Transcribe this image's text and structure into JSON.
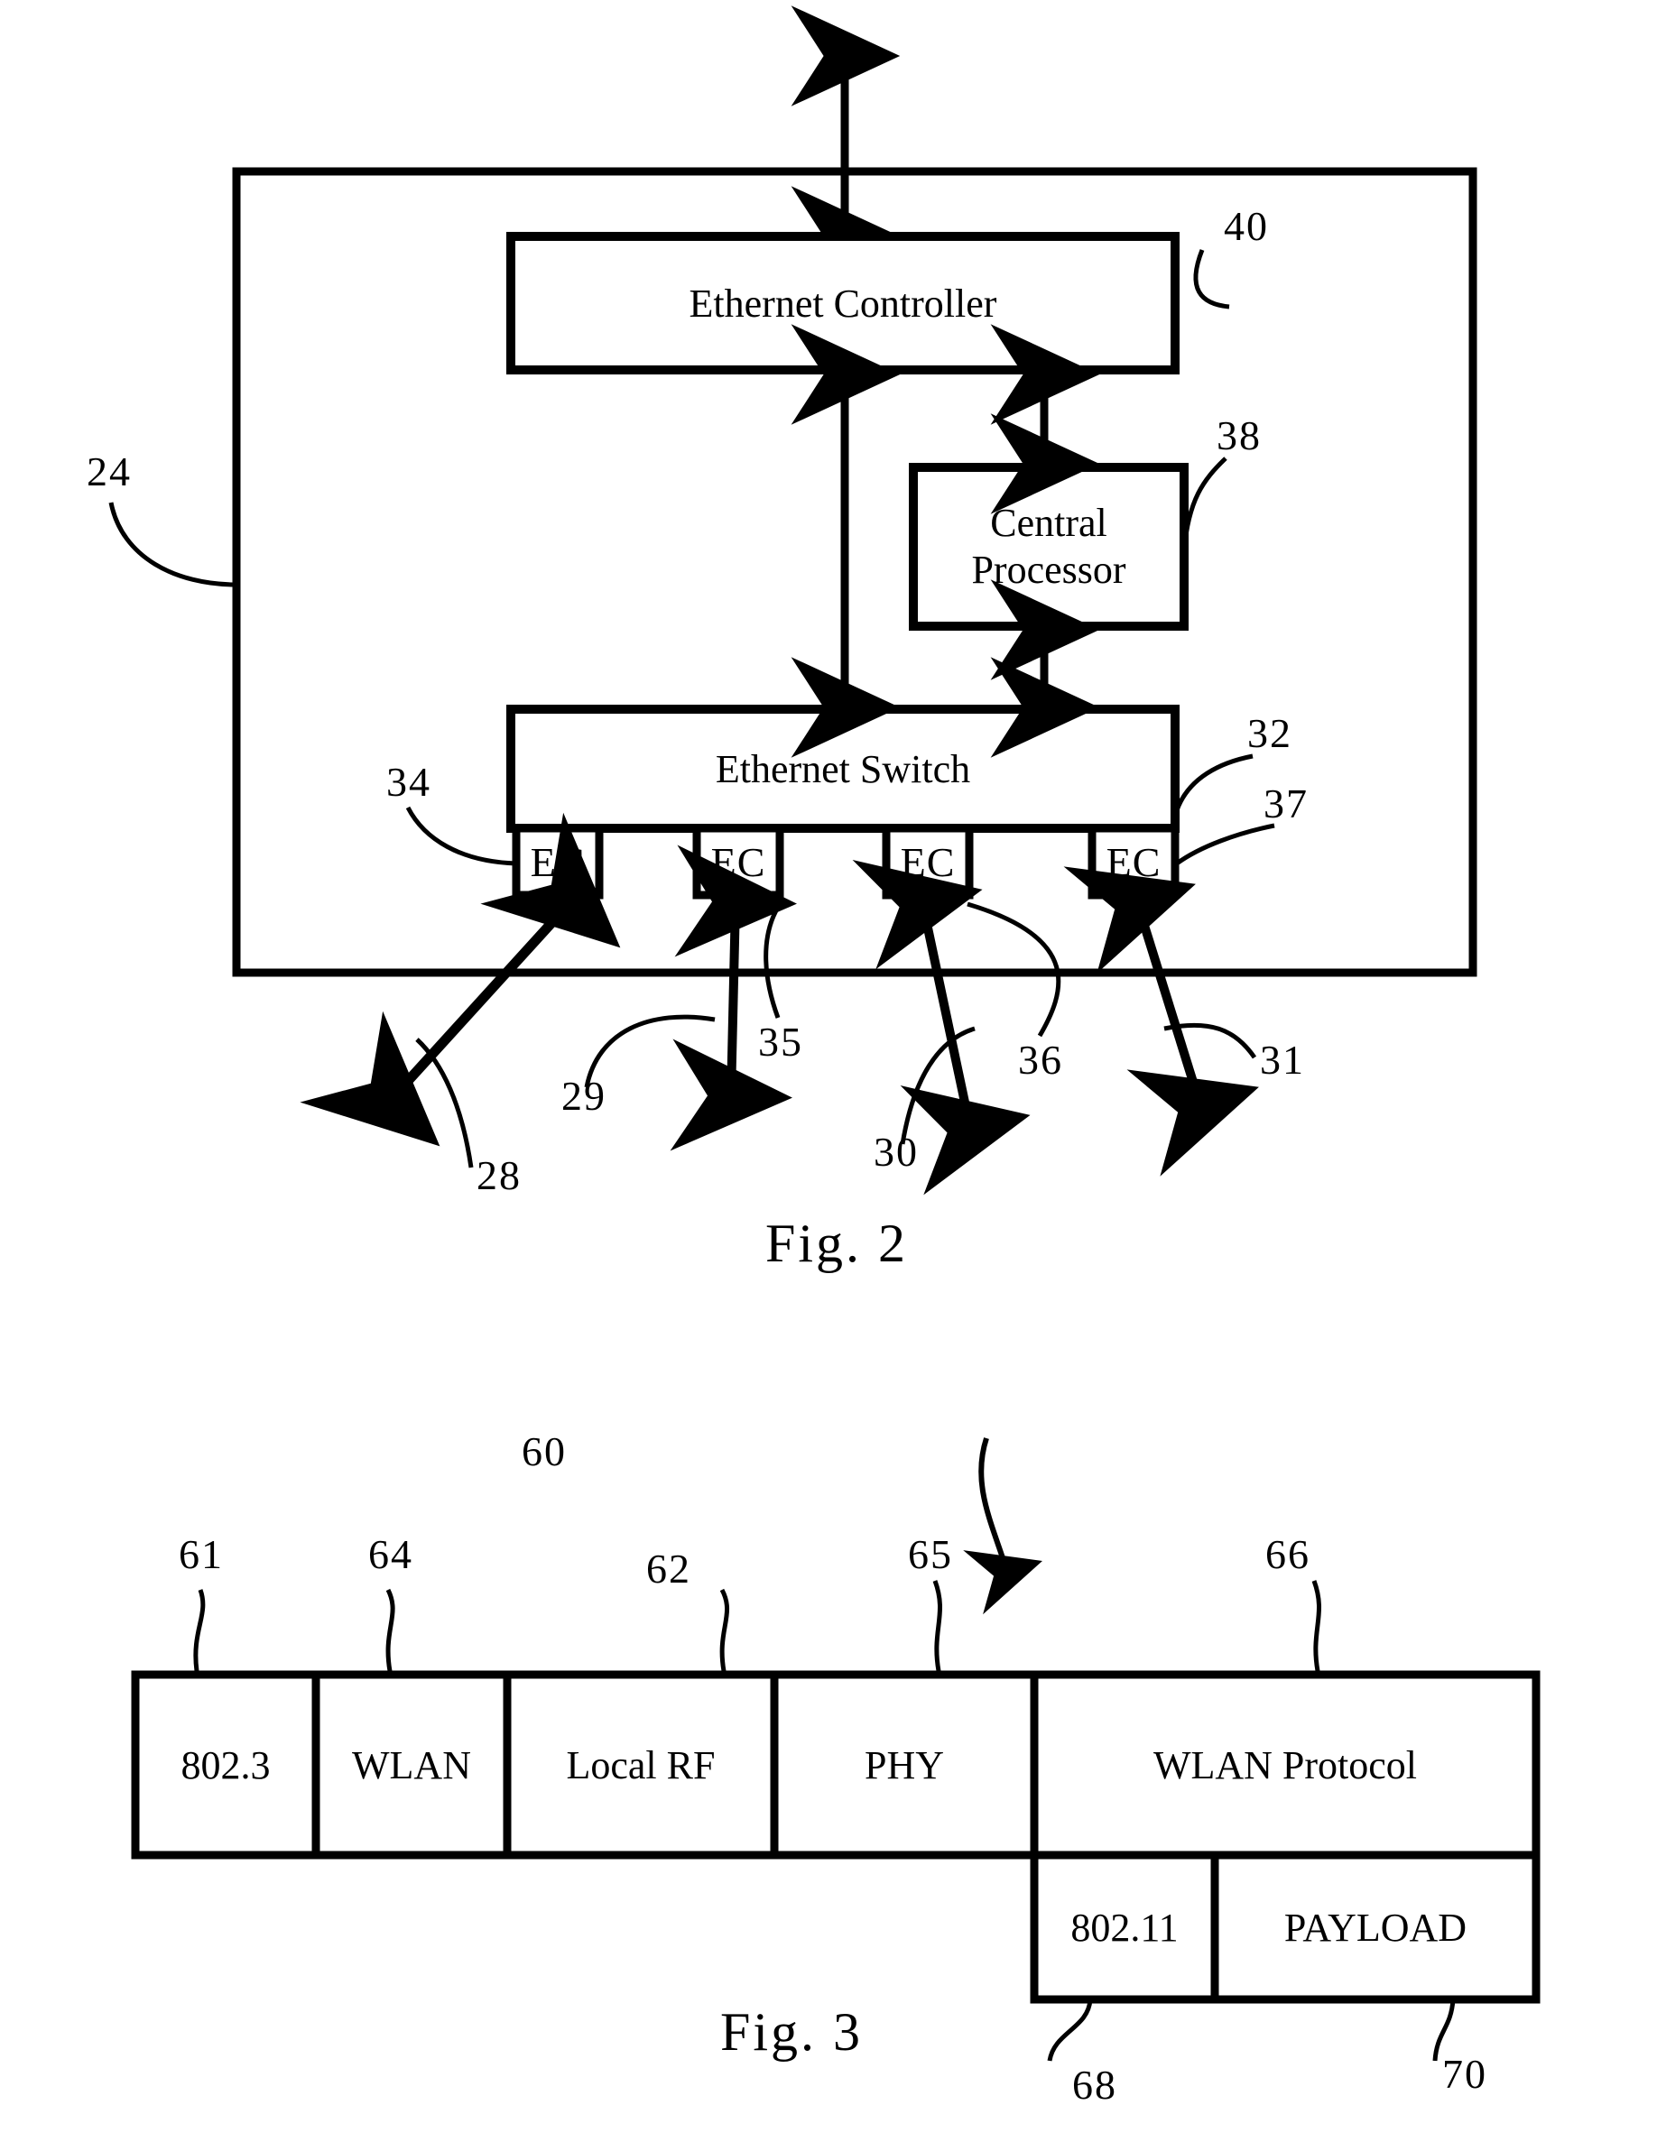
{
  "document": {
    "type": "patent-drawing-sheet",
    "figures": [
      "Fig. 2",
      "Fig. 3"
    ]
  },
  "figure2": {
    "caption": "Fig. 2",
    "enclosure_ref": "24",
    "blocks": [
      {
        "id": "ethernet-controller",
        "label": "Ethernet Controller",
        "ref": "40"
      },
      {
        "id": "central-processor",
        "label": "Central\nProcessor",
        "label_line1": "Central",
        "label_line2": "Processor",
        "ref": "38"
      },
      {
        "id": "ethernet-switch",
        "label": "Ethernet Switch",
        "ref": "32"
      }
    ],
    "ec_ports": [
      {
        "label": "EC",
        "ref": "34",
        "link_ref": "28"
      },
      {
        "label": "EC",
        "ref": "35",
        "link_ref": "29"
      },
      {
        "label": "EC",
        "ref": "36",
        "link_ref": "30"
      },
      {
        "label": "EC",
        "ref": "37",
        "link_ref": "31"
      }
    ],
    "reference_numerals": [
      "24",
      "40",
      "38",
      "32",
      "34",
      "35",
      "36",
      "37",
      "28",
      "29",
      "30",
      "31"
    ]
  },
  "figure3": {
    "caption": "Fig. 3",
    "overall_ref": "60",
    "top_row": [
      {
        "label": "802.3",
        "ref": "61"
      },
      {
        "label": "WLAN",
        "ref": "64"
      },
      {
        "label": "Local RF",
        "ref": "62"
      },
      {
        "label": "PHY",
        "ref": "65"
      },
      {
        "label": "WLAN Protocol",
        "ref": "66"
      }
    ],
    "bottom_row": [
      {
        "label": "802.11",
        "ref": "68"
      },
      {
        "label": "PAYLOAD",
        "ref": "70"
      }
    ],
    "reference_numerals": [
      "60",
      "61",
      "62",
      "64",
      "65",
      "66",
      "68",
      "70"
    ]
  },
  "colors": {
    "ink": "#000000",
    "paper": "#ffffff"
  }
}
